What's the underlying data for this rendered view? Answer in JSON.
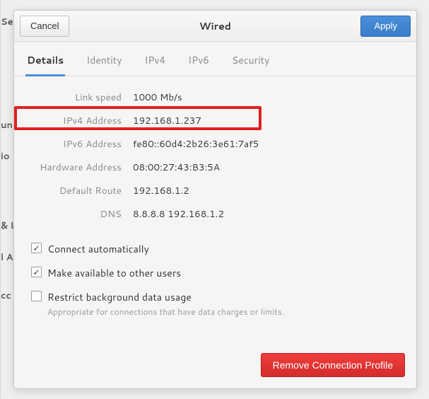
{
  "background": {
    "fragments": [
      "Se",
      "un",
      "io",
      "& L",
      "l A",
      "cc"
    ]
  },
  "dialog": {
    "title": "Wired",
    "cancel_label": "Cancel",
    "apply_label": "Apply"
  },
  "tabs": [
    {
      "id": "details",
      "label": "Details",
      "active": true
    },
    {
      "id": "identity",
      "label": "Identity",
      "active": false
    },
    {
      "id": "ipv4",
      "label": "IPv4",
      "active": false
    },
    {
      "id": "ipv6",
      "label": "IPv6",
      "active": false
    },
    {
      "id": "security",
      "label": "Security",
      "active": false
    }
  ],
  "details": {
    "rows": [
      {
        "label": "Link speed",
        "value": "1000 Mb/s",
        "highlighted": false
      },
      {
        "label": "IPv4 Address",
        "value": "192.168.1.237",
        "highlighted": true
      },
      {
        "label": "IPv6 Address",
        "value": "fe80::60d4:2b26:3e61:7af5",
        "highlighted": false
      },
      {
        "label": "Hardware Address",
        "value": "08:00:27:43:B3:5A",
        "highlighted": false
      },
      {
        "label": "Default Route",
        "value": "192.168.1.2",
        "highlighted": false
      },
      {
        "label": "DNS",
        "value": "8.8.8.8 192.168.1.2",
        "highlighted": false
      }
    ]
  },
  "checkboxes": [
    {
      "id": "connect-auto",
      "label": "Connect automatically",
      "checked": true,
      "sub": null
    },
    {
      "id": "other-users",
      "label": "Make available to other users",
      "checked": true,
      "sub": null
    },
    {
      "id": "restrict-bg",
      "label": "Restrict background data usage",
      "checked": false,
      "sub": "Appropriate for connections that have data charges or limits."
    }
  ],
  "footer": {
    "remove_label": "Remove Connection Profile"
  }
}
